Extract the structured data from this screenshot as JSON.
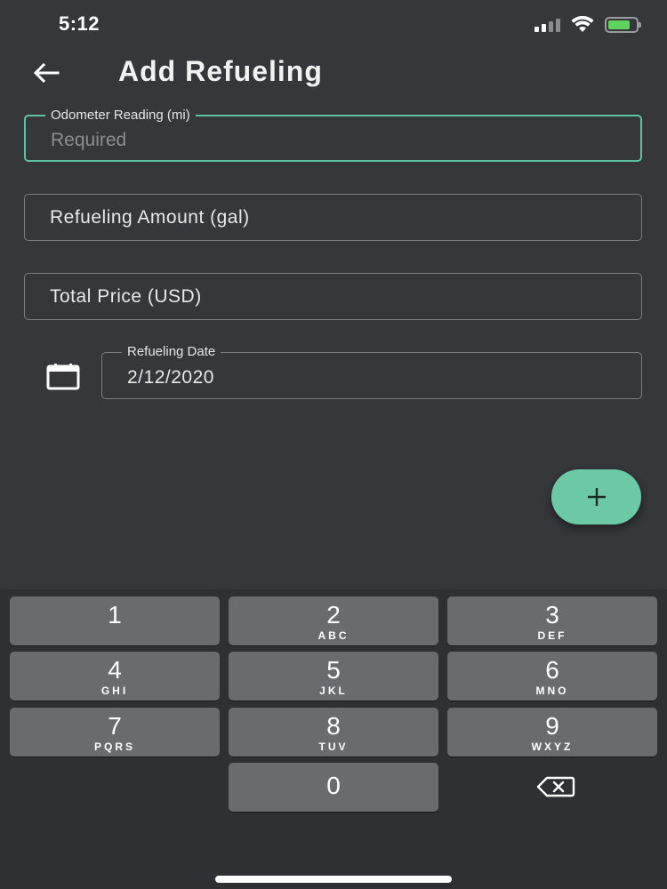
{
  "status_bar": {
    "time": "5:12",
    "icons": [
      "signal-icon",
      "wifi-icon",
      "battery-charging-icon"
    ],
    "battery_color": "#5fd25d"
  },
  "header": {
    "back_icon": "arrow-left-icon",
    "title": "Add Refueling"
  },
  "form": {
    "odometer": {
      "label": "Odometer Reading (mi)",
      "placeholder": "Required",
      "value": ""
    },
    "amount": {
      "placeholder": "Refueling Amount (gal)",
      "value": ""
    },
    "price": {
      "placeholder": "Total Price (USD)",
      "value": ""
    },
    "date": {
      "label": "Refueling Date",
      "value": "2/12/2020",
      "icon": "calendar-icon"
    }
  },
  "fab": {
    "icon": "plus-icon",
    "color": "#6cc9a6"
  },
  "keypad": {
    "keys": [
      {
        "digit": "1",
        "letters": ""
      },
      {
        "digit": "2",
        "letters": "ABC"
      },
      {
        "digit": "3",
        "letters": "DEF"
      },
      {
        "digit": "4",
        "letters": "GHI"
      },
      {
        "digit": "5",
        "letters": "JKL"
      },
      {
        "digit": "6",
        "letters": "MNO"
      },
      {
        "digit": "7",
        "letters": "PQRS"
      },
      {
        "digit": "8",
        "letters": "TUV"
      },
      {
        "digit": "9",
        "letters": "WXYZ"
      },
      {
        "digit": "0",
        "letters": ""
      }
    ],
    "delete_icon": "backspace-icon"
  },
  "colors": {
    "background": "#35373b",
    "accent": "#5ec1a4",
    "key": "#696b6f"
  }
}
